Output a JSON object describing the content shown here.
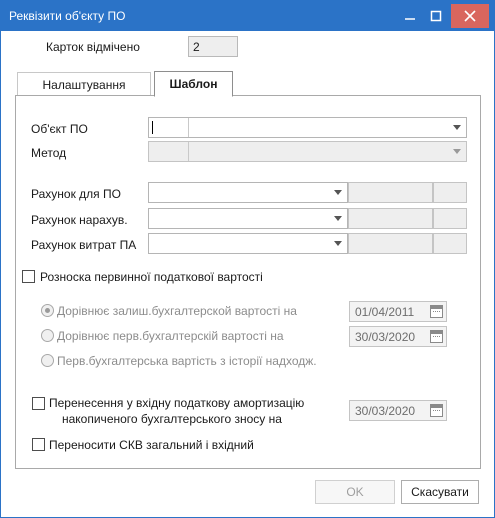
{
  "window": {
    "title": "Реквізити об'єкту ПО"
  },
  "header": {
    "count_label": "Карток відмічено",
    "count_value": "2"
  },
  "tabs": [
    {
      "label": "Налаштування",
      "active": false
    },
    {
      "label": "Шаблон",
      "active": true
    }
  ],
  "template": {
    "object_label": "Об'єкт ПО",
    "method_label": "Метод",
    "account_po_label": "Рахунок для ПО",
    "account_accrual_label": "Рахунок нарахув.",
    "account_expense_label": "Рахунок витрат ПА",
    "distribution_checkbox_label": "Розноска первинної податкової вартості",
    "distribution_checked": false,
    "options": [
      {
        "label": "Дорівнює залиш.бухгалтерской вартості на",
        "date": "01/04/2011",
        "selected": true
      },
      {
        "label": "Дорівнює перв.бухгалтерскій вартості на",
        "date": "30/03/2020",
        "selected": false
      },
      {
        "label": "Перв.бухгалтерська вартість з історії надходж.",
        "selected": false
      }
    ],
    "transfer_label_line1": "Перенесення у вхідну податкову амортизацію",
    "transfer_label_line2": "накопиченого бухгалтерського зносу на",
    "transfer_date": "30/03/2020",
    "transfer_checked": false,
    "skv_label": "Переносити СКВ загальний і вхідний",
    "skv_checked": false
  },
  "buttons": {
    "ok": "OK",
    "cancel": "Скасувати"
  },
  "icons": {
    "minimize": "minimize-icon",
    "maximize": "maximize-icon",
    "close": "close-icon",
    "calendar": "calendar-icon",
    "dropdown": "chevron-down-icon"
  },
  "colors": {
    "titlebar": "#2b73c7",
    "close_button": "#d9665e"
  }
}
